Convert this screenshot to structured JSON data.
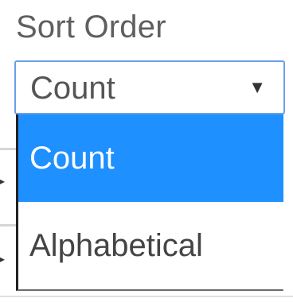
{
  "sort": {
    "label": "Sort Order",
    "selected_value": "Count",
    "caret_icon": "▼",
    "options": [
      {
        "label": "Count",
        "selected": true
      },
      {
        "label": "Alphabetical",
        "selected": false
      }
    ]
  },
  "colors": {
    "highlight": "#1e90ff",
    "focus_border": "#6b9fe6"
  },
  "background_ticks": [
    "▸",
    "▸"
  ]
}
